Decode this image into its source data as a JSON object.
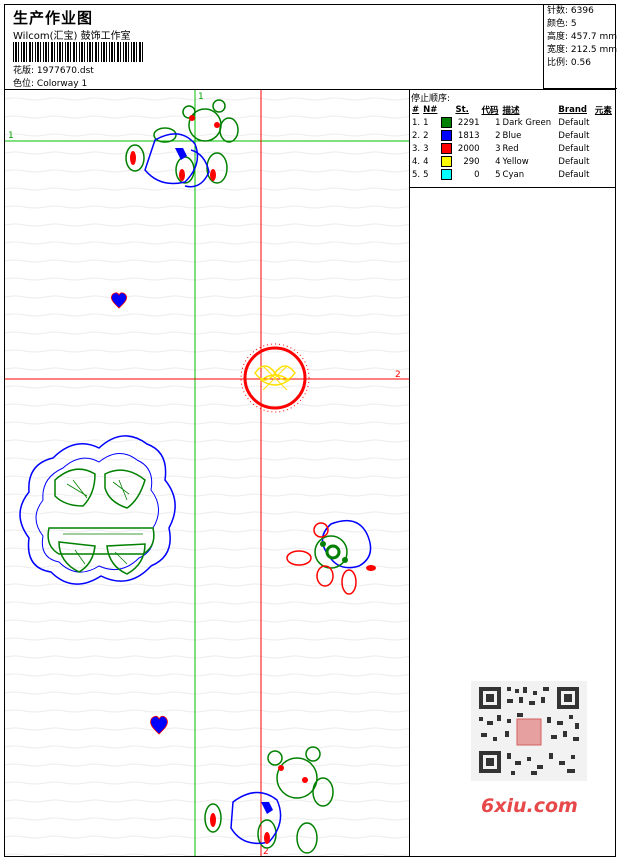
{
  "header": {
    "title": "生产作业图",
    "company": "Wilcom(汇宝) 鼓饰工作室",
    "design_label": "花版:",
    "design_file": "1977670.dst",
    "colorway_label": "色位:",
    "colorway": "Colorway 1"
  },
  "properties": {
    "stitches": "针数: 6396",
    "colors": "颜色: 5",
    "height": "高度: 457.7 mm",
    "width": "宽度: 212.5 mm",
    "scale": "比例: 0.56"
  },
  "stop_sequence": {
    "title": "停止顺序:",
    "columns": [
      "#",
      "N#",
      "St.",
      "代码",
      "描述",
      "Brand",
      "元素"
    ],
    "rows": [
      {
        "num": "1.",
        "n": "1",
        "color": "#008000",
        "stitches": "2291",
        "code": "1",
        "desc": "Dark Green",
        "brand": "Default"
      },
      {
        "num": "2.",
        "n": "2",
        "color": "#0000ff",
        "stitches": "1813",
        "code": "2",
        "desc": "Blue",
        "brand": "Default"
      },
      {
        "num": "3.",
        "n": "3",
        "color": "#ff0000",
        "stitches": "2000",
        "code": "3",
        "desc": "Red",
        "brand": "Default"
      },
      {
        "num": "4.",
        "n": "4",
        "color": "#ffff00",
        "stitches": "290",
        "code": "4",
        "desc": "Yellow",
        "brand": "Default"
      },
      {
        "num": "5.",
        "n": "5",
        "color": "#00ffff",
        "stitches": "0",
        "code": "5",
        "desc": "Cyan",
        "brand": "Default"
      }
    ]
  },
  "guides": {
    "h1": "1",
    "h2": "2",
    "v1": "1",
    "v2": "2",
    "green": "#00c000",
    "red": "#ff0000"
  },
  "watermark": {
    "brand": "6xiu.com",
    "color": "#e7494a"
  }
}
